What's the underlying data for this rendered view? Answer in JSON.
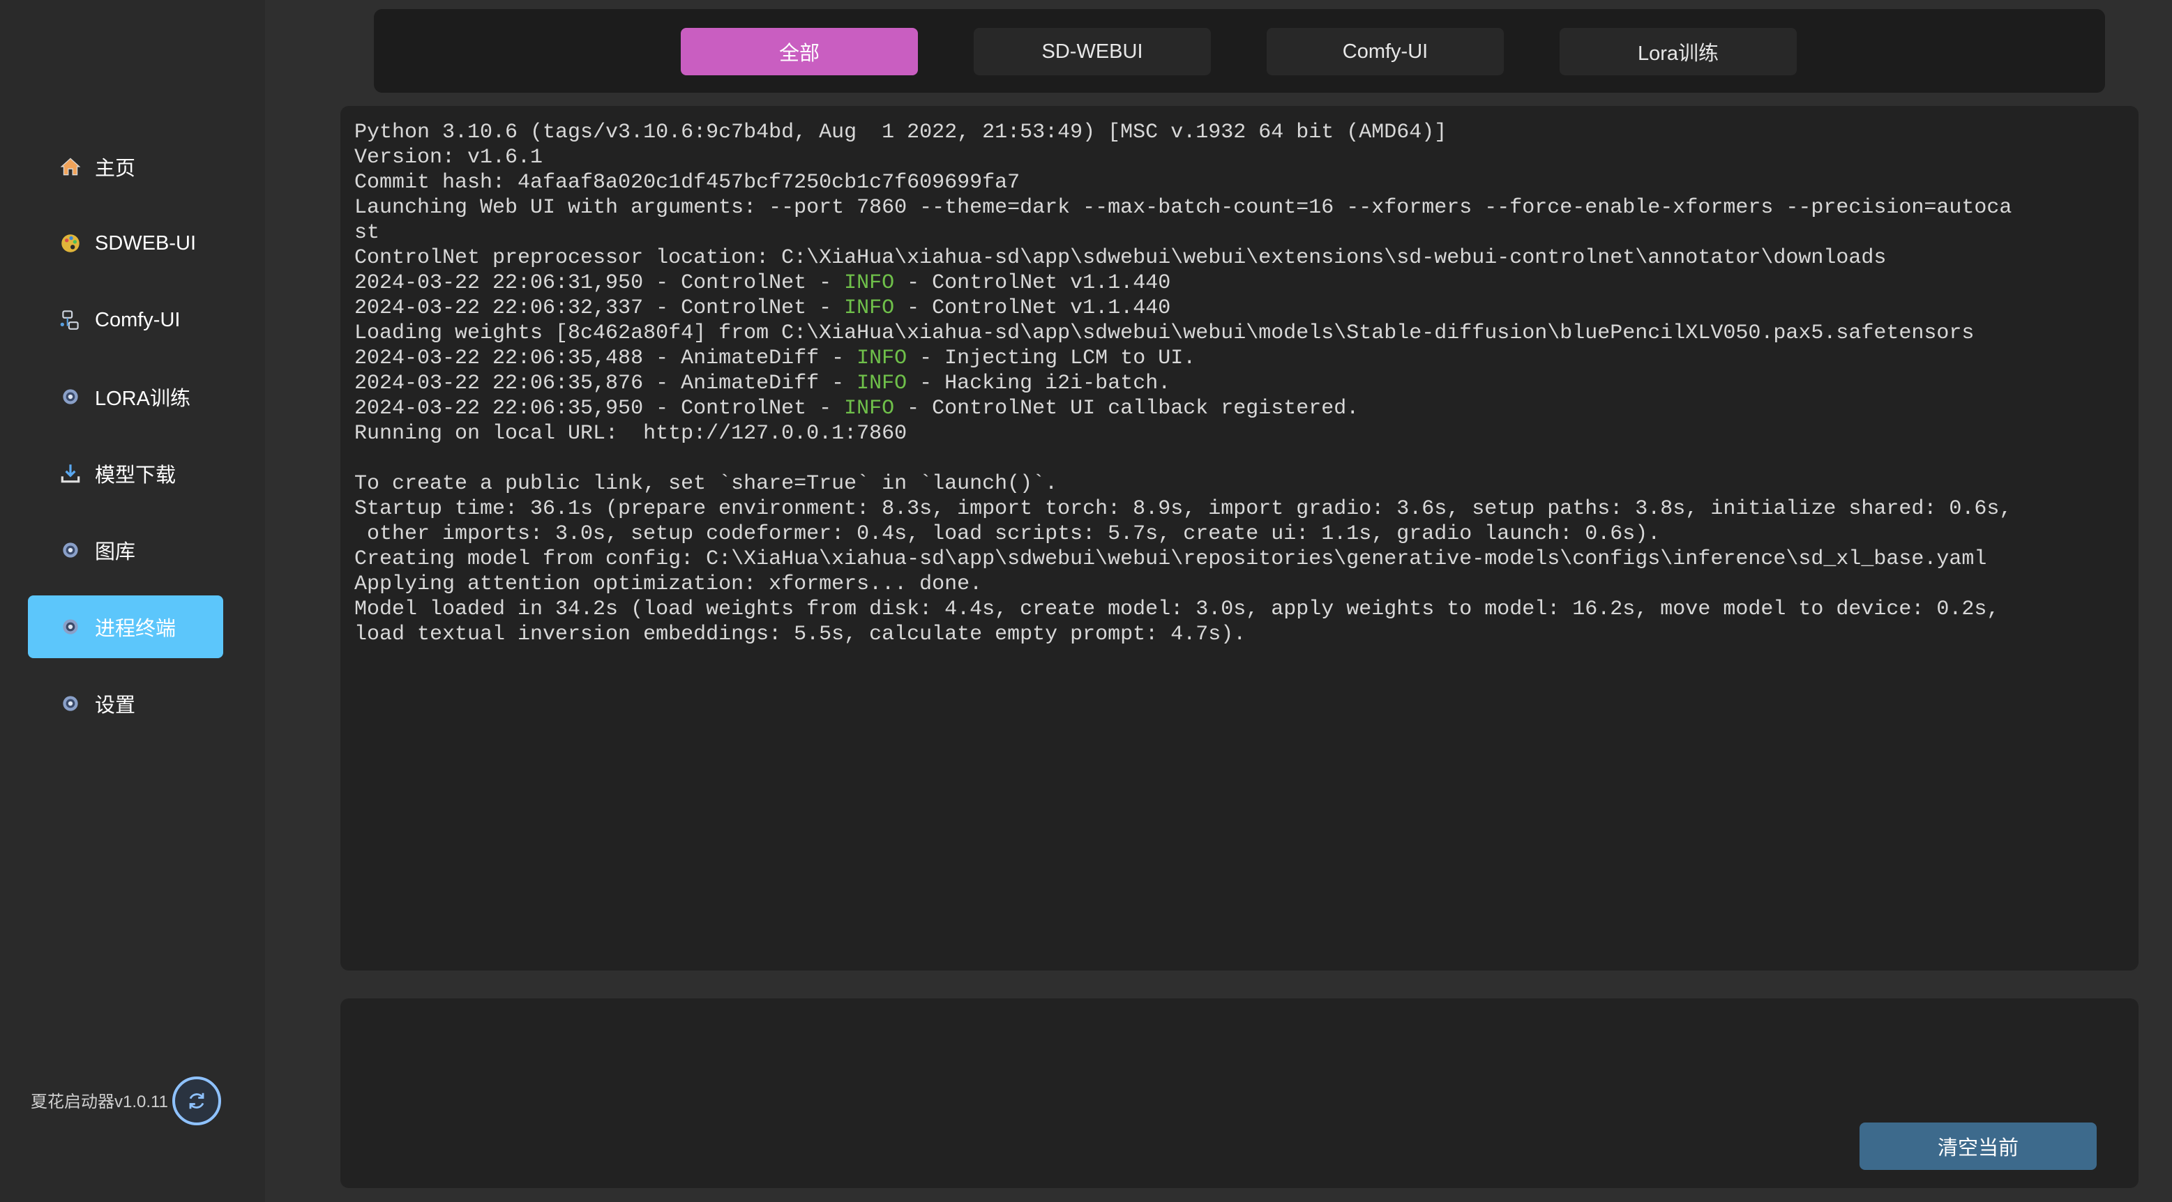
{
  "sidebar": {
    "items": [
      {
        "label": "主页",
        "icon": "home-icon"
      },
      {
        "label": "SDWEB-UI",
        "icon": "palette-icon"
      },
      {
        "label": "Comfy-UI",
        "icon": "workflow-icon"
      },
      {
        "label": "LORA训练",
        "icon": "gear-icon"
      },
      {
        "label": "模型下载",
        "icon": "download-icon"
      },
      {
        "label": "图库",
        "icon": "gear-icon"
      },
      {
        "label": "进程终端",
        "icon": "gear-icon"
      },
      {
        "label": "设置",
        "icon": "gear-icon"
      }
    ],
    "active_index": 6,
    "version": "夏花启动器v1.0.11"
  },
  "tabs": {
    "items": [
      "全部",
      "SD-WEBUI",
      "Comfy-UI",
      "Lora训练"
    ],
    "active_index": 0
  },
  "console": {
    "lines": [
      {
        "pre": "Python 3.10.6 (tags/v3.10.6:9c7b4bd, Aug  1 2022, 21:53:49) [MSC v.1932 64 bit (AMD64)]"
      },
      {
        "pre": "Version: v1.6.1"
      },
      {
        "pre": "Commit hash: 4afaaf8a020c1df457bcf7250cb1c7f609699fa7"
      },
      {
        "pre": "Launching Web UI with arguments: --port 7860 --theme=dark --max-batch-count=16 --xformers --force-enable-xformers --precision=autoca"
      },
      {
        "pre": "st"
      },
      {
        "pre": "ControlNet preprocessor location: C:\\XiaHua\\xiahua-sd\\app\\sdwebui\\webui\\extensions\\sd-webui-controlnet\\annotator\\downloads"
      },
      {
        "pre": "2024-03-22 22:06:31,950 - ControlNet - ",
        "info": "INFO",
        "post": " - ControlNet v1.1.440"
      },
      {
        "pre": "2024-03-22 22:06:32,337 - ControlNet - ",
        "info": "INFO",
        "post": " - ControlNet v1.1.440"
      },
      {
        "pre": "Loading weights [8c462a80f4] from C:\\XiaHua\\xiahua-sd\\app\\sdwebui\\webui\\models\\Stable-diffusion\\bluePencilXLV050.pax5.safetensors"
      },
      {
        "pre": "2024-03-22 22:06:35,488 - AnimateDiff - ",
        "info": "INFO",
        "post": " - Injecting LCM to UI."
      },
      {
        "pre": "2024-03-22 22:06:35,876 - AnimateDiff - ",
        "info": "INFO",
        "post": " - Hacking i2i-batch."
      },
      {
        "pre": "2024-03-22 22:06:35,950 - ControlNet - ",
        "info": "INFO",
        "post": " - ControlNet UI callback registered."
      },
      {
        "pre": "Running on local URL:  http://127.0.0.1:7860"
      },
      {
        "pre": ""
      },
      {
        "pre": "To create a public link, set `share=True` in `launch()`."
      },
      {
        "pre": "Startup time: 36.1s (prepare environment: 8.3s, import torch: 8.9s, import gradio: 3.6s, setup paths: 3.8s, initialize shared: 0.6s,"
      },
      {
        "pre": " other imports: 3.0s, setup codeformer: 0.4s, load scripts: 5.7s, create ui: 1.1s, gradio launch: 0.6s)."
      },
      {
        "pre": "Creating model from config: C:\\XiaHua\\xiahua-sd\\app\\sdwebui\\webui\\repositories\\generative-models\\configs\\inference\\sd_xl_base.yaml"
      },
      {
        "pre": "Applying attention optimization: xformers... done."
      },
      {
        "pre": "Model loaded in 34.2s (load weights from disk: 4.4s, create model: 3.0s, apply weights to model: 16.2s, move model to device: 0.2s,"
      },
      {
        "pre": "load textual inversion embeddings: 5.5s, calculate empty prompt: 4.7s)."
      }
    ]
  },
  "panel": {
    "clear_label": "清空当前"
  },
  "colors": {
    "active_tab": "#c95ec1",
    "active_nav": "#5cc6fb",
    "clear_button": "#3d6a8c",
    "info_text": "#6fc04a"
  }
}
